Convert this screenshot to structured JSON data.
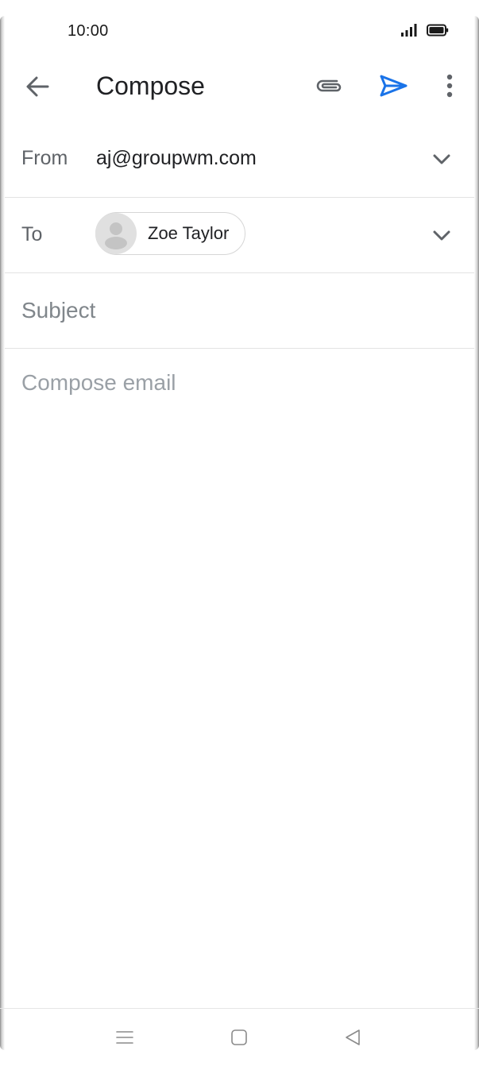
{
  "status_bar": {
    "time": "10:00"
  },
  "app_bar": {
    "title": "Compose",
    "back_icon": "arrow-back-icon",
    "attach_icon": "paperclip-icon",
    "send_icon": "send-icon",
    "more_icon": "more-vert-icon"
  },
  "from": {
    "label": "From",
    "value": "aj@groupwm.com"
  },
  "to": {
    "label": "To",
    "recipients": [
      {
        "name": "Zoe Taylor"
      }
    ]
  },
  "subject": {
    "value": "",
    "placeholder": "Subject"
  },
  "body": {
    "value": "",
    "placeholder": "Compose email"
  },
  "colors": {
    "accent": "#1a73e8",
    "icon_gray": "#5f6368",
    "text_primary": "#202124",
    "divider": "#e3e3e3"
  }
}
